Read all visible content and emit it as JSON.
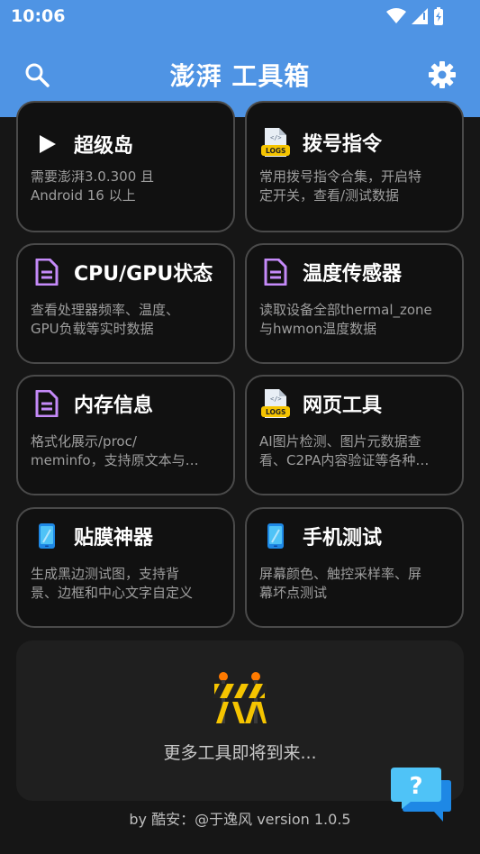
{
  "status_bar": {
    "time": "10:06"
  },
  "app_bar": {
    "title": "澎湃 工具箱"
  },
  "cards": [
    {
      "name": "超级岛",
      "desc": "需要澎湃3.0.300 且\nAndroid 16 以上"
    },
    {
      "name": "拨号指令",
      "desc": "常用拨号指令合集，开启特\n定开关，查看/测试数据"
    },
    {
      "name": "CPU/GPU状态",
      "desc": "查看处理器频率、温度、\nGPU负载等实时数据"
    },
    {
      "name": "温度传感器",
      "desc": "读取设备全部thermal_zone\n与hwmon温度数据"
    },
    {
      "name": "内存信息",
      "desc": "格式化展示/proc/\nmeminfo，支持原文本与…"
    },
    {
      "name": "网页工具",
      "desc": "AI图片检测、图片元数据查\n看、C2PA内容验证等各种…"
    },
    {
      "name": "贴膜神器",
      "desc": "生成黑边测试图，支持背\n景、边框和中心文字自定义"
    },
    {
      "name": "手机测试",
      "desc": "屏幕颜色、触控采样率、屏\n幕坏点测试"
    }
  ],
  "more": {
    "text": "更多工具即将到来..."
  },
  "footer": {
    "text": "by 酷安：@于逸风 version 1.0.5"
  },
  "help": {
    "label": "?"
  },
  "colors": {
    "accent": "#4f94e4",
    "icon_purple": "#c58af9",
    "card_border": "#4a4a4a",
    "background": "#161616"
  }
}
